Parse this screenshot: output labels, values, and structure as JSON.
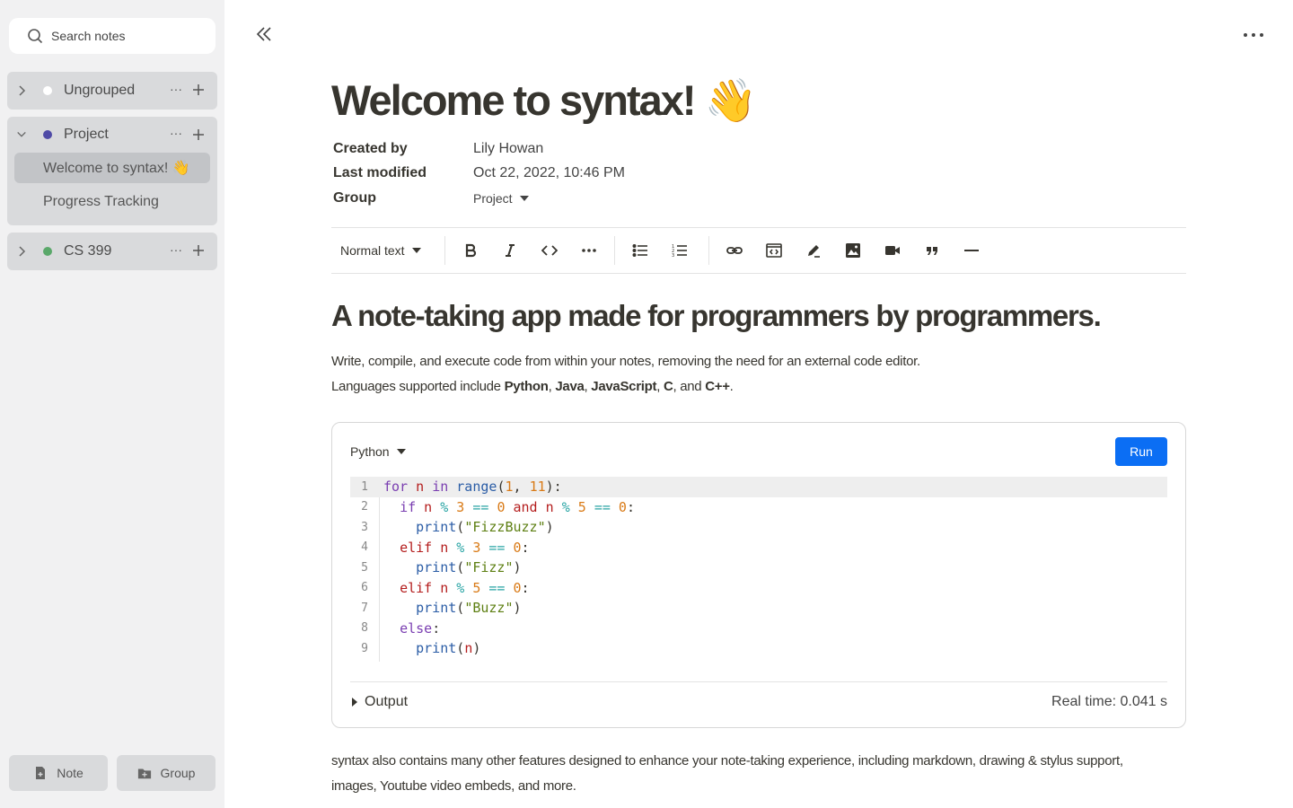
{
  "sidebar": {
    "search_placeholder": "Search notes",
    "groups": [
      {
        "name": "Ungrouped",
        "color": "#ffffff",
        "expanded": false
      },
      {
        "name": "Project",
        "color": "#4f4aa6",
        "expanded": true,
        "notes": [
          {
            "title": "Welcome to syntax! 👋"
          },
          {
            "title": "Progress Tracking"
          }
        ]
      },
      {
        "name": "CS 399",
        "color": "#5aa86a",
        "expanded": false
      }
    ],
    "more": "···",
    "buttons": {
      "note": "Note",
      "group": "Group"
    }
  },
  "note": {
    "title": "Welcome to syntax! 👋",
    "props": {
      "created_by_label": "Created by",
      "created_by": "Lily Howan",
      "modified_label": "Last modified",
      "modified": "Oct 22, 2022, 10:46 PM",
      "group_label": "Group",
      "group": "Project"
    },
    "toolbar": {
      "text_style": "Normal text"
    },
    "heading": "A note-taking app made for programmers by programmers.",
    "para1": "Write, compile, and execute code from within your notes, removing the need for an external code editor.",
    "para2": {
      "prefix": "Languages supported include ",
      "l1": "Python",
      "c1": ", ",
      "l2": "Java",
      "c2": ", ",
      "l3": "JavaScript",
      "c3": ", ",
      "l4": "C",
      "c4": ", and ",
      "l5": "C++",
      "end": "."
    },
    "code": {
      "language": "Python",
      "run_label": "Run",
      "line_numbers": [
        "1",
        "2",
        "3",
        "4",
        "5",
        "6",
        "7",
        "8",
        "9"
      ],
      "output_label": "Output",
      "real_time": "Real time: 0.041 s"
    },
    "para3_line1": "syntax also contains many other features designed to enhance your note-taking experience, including markdown, drawing & stylus support,",
    "para3_line2": "images, Youtube video embeds, and more."
  },
  "colors": {
    "accent": "#0b6ef4",
    "sidebar_bg": "#f1f1f2"
  }
}
